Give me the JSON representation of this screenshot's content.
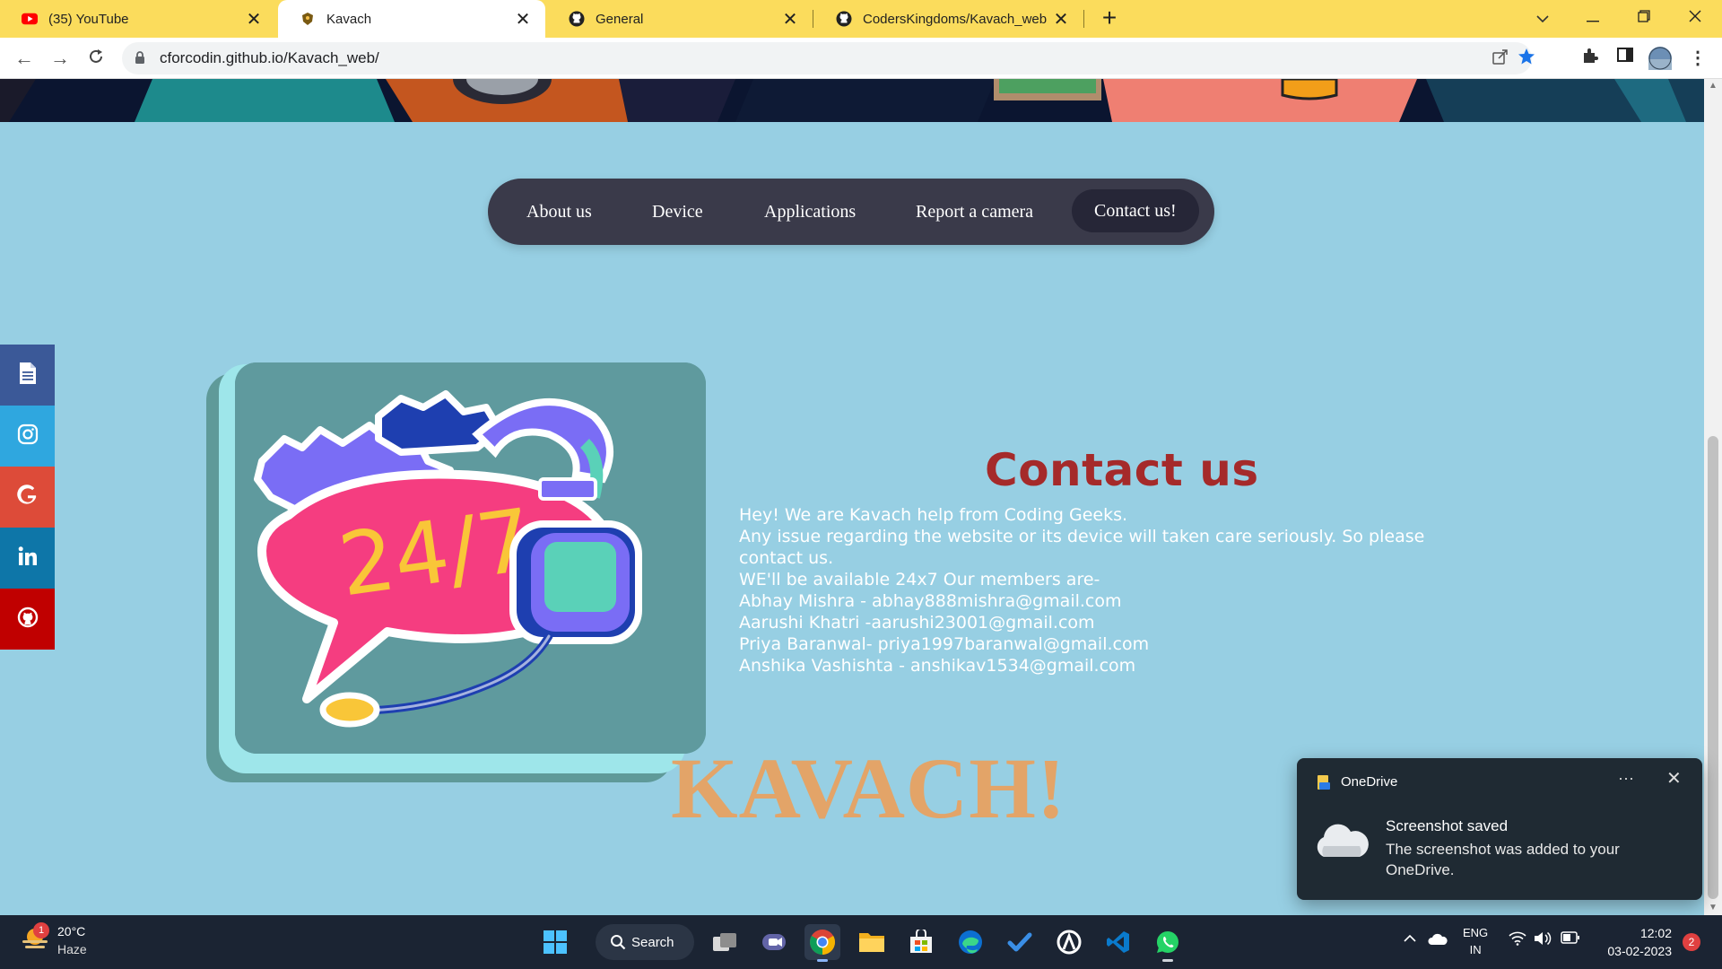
{
  "browser": {
    "tabs": [
      {
        "label": "(35) YouTube",
        "icon": "youtube-icon"
      },
      {
        "label": "Kavach",
        "icon": "kavach-favicon"
      },
      {
        "label": "General",
        "icon": "github-icon"
      },
      {
        "label": "CodersKingdoms/Kavach_web",
        "icon": "github-icon"
      }
    ],
    "active_tab": 1,
    "url": "cforcodin.github.io/Kavach_web/"
  },
  "nav": {
    "items": [
      "About us",
      "Device",
      "Applications",
      "Report a camera",
      "Contact us!"
    ],
    "active": "Contact us!"
  },
  "social": [
    {
      "name": "document",
      "color": "#3b5998"
    },
    {
      "name": "instagram",
      "color": "#2fa7df"
    },
    {
      "name": "google",
      "color": "#dd4b39"
    },
    {
      "name": "linkedin",
      "color": "#0e76a8"
    },
    {
      "name": "github",
      "color": "#c00000"
    }
  ],
  "illustration": {
    "text": "24/7"
  },
  "contact": {
    "title": "Contact us",
    "lines": [
      "Hey! We are Kavach help from Coding Geeks.",
      "Any issue regarding the website or its device will taken care seriously. So please contact us.",
      "WE'll be available 24x7 Our members are-",
      "Abhay Mishra - abhay888mishra@gmail.com",
      "Aarushi Khatri -aarushi23001@gmail.com",
      "Priya Baranwal- priya1997baranwal@gmail.com",
      "Anshika Vashishta - anshikav1534@gmail.com"
    ]
  },
  "brand": {
    "heading": "KAVACH!"
  },
  "toast": {
    "app": "OneDrive",
    "more": "···",
    "title": "Screenshot saved",
    "message": "The screenshot was added to your OneDrive."
  },
  "taskbar": {
    "weather": {
      "temp": "20°C",
      "desc": "Haze",
      "badge": "1"
    },
    "search_label": "Search",
    "language": {
      "line1": "ENG",
      "line2": "IN"
    },
    "time": "12:02",
    "date": "03-02-2023",
    "notification_count": "2"
  },
  "colors": {
    "tab_strip": "#fbdc5c",
    "page_bg": "#97cfe3",
    "nav_pill": "#3a3a4a",
    "contact_title": "#a52a2a",
    "brand_heading": "#e3a468"
  }
}
